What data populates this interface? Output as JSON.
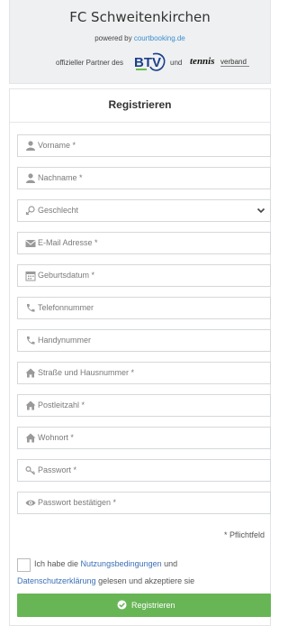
{
  "header": {
    "club_name": "FC Schweitenkirchen",
    "powered_prefix": "powered by ",
    "powered_link": "courtbooking.de",
    "partner_prefix": "offizieller Partner des",
    "btv_logo_text": "BTV",
    "partner_and": "und",
    "tennis_logo_text": "tennis",
    "tennis_logo_text2": "verband"
  },
  "form": {
    "title": "Registrieren",
    "fields": [
      {
        "placeholder": "Vorname *",
        "icon": "user-icon"
      },
      {
        "placeholder": "Nachname *",
        "icon": "user-icon"
      },
      {
        "placeholder": "Geschlecht",
        "icon": "gender-icon",
        "type": "select"
      },
      {
        "placeholder": "E-Mail Adresse *",
        "icon": "envelope-icon"
      },
      {
        "placeholder": "Geburtsdatum *",
        "icon": "calendar-icon"
      },
      {
        "placeholder": "Telefonnummer",
        "icon": "phone-icon"
      },
      {
        "placeholder": "Handynummer",
        "icon": "phone-icon"
      },
      {
        "placeholder": "Straße und Hausnummer *",
        "icon": "home-icon"
      },
      {
        "placeholder": "Postleitzahl *",
        "icon": "home-icon"
      },
      {
        "placeholder": "Wohnort *",
        "icon": "home-icon"
      },
      {
        "placeholder": "Passwort *",
        "icon": "key-icon"
      },
      {
        "placeholder": "Passwort bestätigen *",
        "icon": "eye-icon"
      }
    ],
    "required_note": "* Pflichtfeld",
    "agree": {
      "prefix": "Ich habe die ",
      "terms_link": "Nutzungsbedingungen",
      "middle": " und",
      "privacy_link": "Datenschutzerklärung",
      "suffix": " gelesen und akzeptiere sie"
    },
    "submit_label": "Registrieren"
  },
  "colors": {
    "accent_green": "#68b556",
    "link_blue": "#3b6fb6",
    "header_bg": "#eef0f1"
  }
}
